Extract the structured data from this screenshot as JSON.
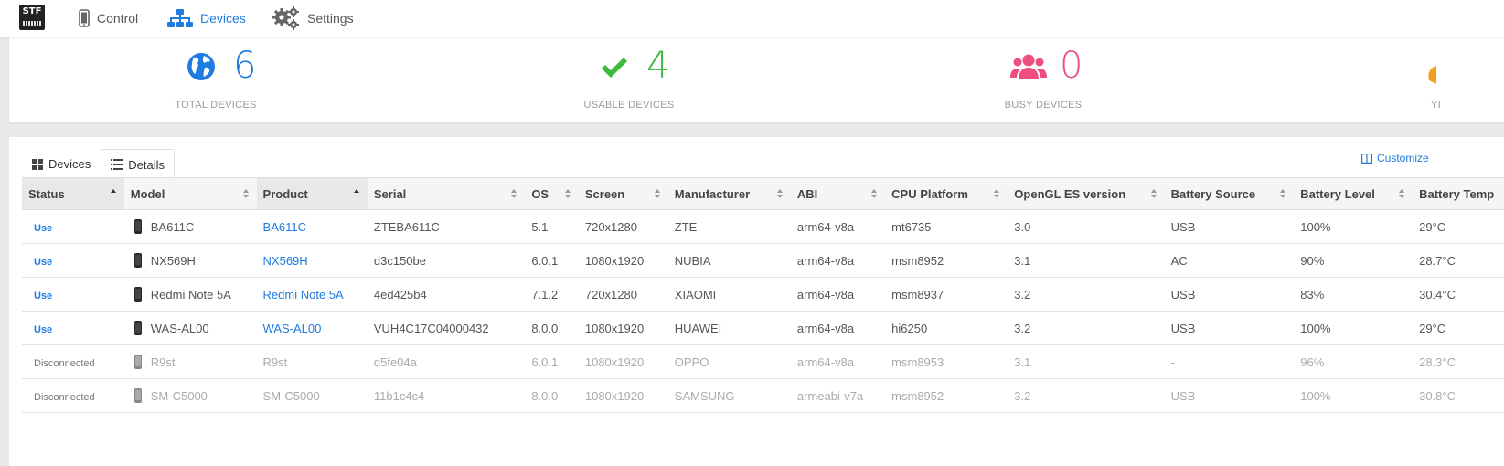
{
  "nav": {
    "logo_text": "STF",
    "items": [
      {
        "label": "Control",
        "icon": "phone-icon"
      },
      {
        "label": "Devices",
        "icon": "sitemap-icon"
      },
      {
        "label": "Settings",
        "icon": "gears-icon"
      }
    ],
    "active": "Devices"
  },
  "stats": [
    {
      "value": "6",
      "label": "TOTAL DEVICES",
      "icon": "globe-icon",
      "color": "#1e7be0"
    },
    {
      "value": "4",
      "label": "USABLE DEVICES",
      "icon": "check-icon",
      "color": "#3fb93f"
    },
    {
      "value": "0",
      "label": "BUSY DEVICES",
      "icon": "users-icon",
      "color": "#ee4f7f"
    },
    {
      "value": "",
      "label": "YI",
      "icon": "partial-icon",
      "color": "#f0a020"
    }
  ],
  "tabs": [
    {
      "label": "Devices",
      "icon": "grid-icon"
    },
    {
      "label": "Details",
      "icon": "list-icon"
    }
  ],
  "customize_label": "Customize",
  "table": {
    "columns": [
      "Status",
      "Model",
      "Product",
      "Serial",
      "OS",
      "Screen",
      "Manufacturer",
      "ABI",
      "CPU Platform",
      "OpenGL ES version",
      "Battery Source",
      "Battery Level",
      "Battery Temp"
    ],
    "rows": [
      {
        "status": "Use",
        "model": "BA611C",
        "product": "BA611C",
        "serial": "ZTEBA611C",
        "os": "5.1",
        "screen": "720x1280",
        "manufacturer": "ZTE",
        "abi": "arm64-v8a",
        "cpu": "mt6735",
        "opengl": "3.0",
        "battery_source": "USB",
        "battery_level": "100%",
        "battery_temp": "29°C"
      },
      {
        "status": "Use",
        "model": "NX569H",
        "product": "NX569H",
        "serial": "d3c150be",
        "os": "6.0.1",
        "screen": "1080x1920",
        "manufacturer": "NUBIA",
        "abi": "arm64-v8a",
        "cpu": "msm8952",
        "opengl": "3.1",
        "battery_source": "AC",
        "battery_level": "90%",
        "battery_temp": "28.7°C"
      },
      {
        "status": "Use",
        "model": "Redmi Note 5A",
        "product": "Redmi Note 5A",
        "serial": "4ed425b4",
        "os": "7.1.2",
        "screen": "720x1280",
        "manufacturer": "XIAOMI",
        "abi": "arm64-v8a",
        "cpu": "msm8937",
        "opengl": "3.2",
        "battery_source": "USB",
        "battery_level": "83%",
        "battery_temp": "30.4°C"
      },
      {
        "status": "Use",
        "model": "WAS-AL00",
        "product": "WAS-AL00",
        "serial": "VUH4C17C04000432",
        "os": "8.0.0",
        "screen": "1080x1920",
        "manufacturer": "HUAWEI",
        "abi": "arm64-v8a",
        "cpu": "hi6250",
        "opengl": "3.2",
        "battery_source": "USB",
        "battery_level": "100%",
        "battery_temp": "29°C"
      },
      {
        "status": "Disconnected",
        "model": "R9st",
        "product": "R9st",
        "serial": "d5fe04a",
        "os": "6.0.1",
        "screen": "1080x1920",
        "manufacturer": "OPPO",
        "abi": "arm64-v8a",
        "cpu": "msm8953",
        "opengl": "3.1",
        "battery_source": "-",
        "battery_level": "96%",
        "battery_temp": "28.3°C"
      },
      {
        "status": "Disconnected",
        "model": "SM-C5000",
        "product": "SM-C5000",
        "serial": "11b1c4c4",
        "os": "8.0.0",
        "screen": "1080x1920",
        "manufacturer": "SAMSUNG",
        "abi": "armeabi-v7a",
        "cpu": "msm8952",
        "opengl": "3.2",
        "battery_source": "USB",
        "battery_level": "100%",
        "battery_temp": "30.8°C"
      }
    ]
  }
}
